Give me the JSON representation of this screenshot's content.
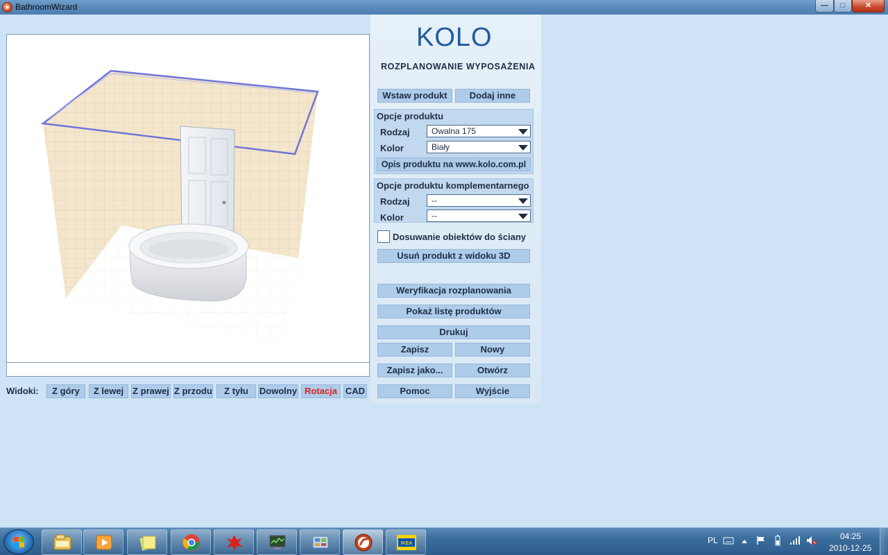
{
  "window": {
    "title": "BathroomWizard",
    "min_glyph": "—",
    "max_glyph": "□",
    "close_glyph": "✕"
  },
  "brand": {
    "logo": "KOLO",
    "subtitle": "ROZPLANOWANIE WYPOSAŻENIA"
  },
  "actions": {
    "insert_product": "Wstaw produkt",
    "add_other": "Dodaj inne"
  },
  "product_options": {
    "title": "Opcje produktu",
    "type_label": "Rodzaj",
    "type_value": "Owalna 175",
    "color_label": "Kolor",
    "color_value": "Biały",
    "description_button": "Opis produktu na www.kolo.com.pl"
  },
  "complementary_options": {
    "title": "Opcje produktu komplementarnego",
    "type_label": "Rodzaj",
    "type_value": "--",
    "color_label": "Kolor",
    "color_value": "--"
  },
  "snap_to_wall": {
    "label": "Dosuwanie obiektów do ściany",
    "checked": false
  },
  "buttons": {
    "remove_3d": "Usuń produkt z widoku 3D",
    "verify": "Weryfikacja rozplanowania",
    "show_list": "Pokaż listę produktów",
    "print": "Drukuj",
    "save": "Zapisz",
    "new": "Nowy",
    "save_as": "Zapisz jako...",
    "open": "Otwórz",
    "help": "Pomoc",
    "exit": "Wyjście"
  },
  "views": {
    "label": "Widoki:",
    "items": [
      "Z góry",
      "Z lewej",
      "Z prawej",
      "Z przodu",
      "Z tyłu",
      "Dowolny",
      "Rotacja",
      "CAD"
    ],
    "active": "Rotacja"
  },
  "taskbar": {
    "language": "PL",
    "time": "04:25",
    "date": "2010-12-25",
    "ikea_label": "IKEA"
  },
  "colors": {
    "accent_blue": "#1f5aa0",
    "button_bg": "#aecbea",
    "active_view": "#e2231a"
  }
}
